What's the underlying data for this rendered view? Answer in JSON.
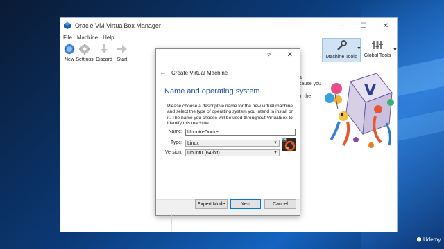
{
  "window": {
    "title": "Oracle VM VirtualBox Manager",
    "controls": {
      "minimize": "—",
      "maximize": "☐",
      "close": "✕"
    }
  },
  "menu": [
    "File",
    "Machine",
    "Help"
  ],
  "toolbar": {
    "new": "New",
    "settings": "Settings",
    "discard": "Discard",
    "start": "Start",
    "machine_tools": "Machine Tools",
    "global_tools": "Global Tools"
  },
  "welcome_fragments": "al\ncause you\n\nin the\nl",
  "dialog": {
    "help": "?",
    "close": "✕",
    "back": "←",
    "title": "Create Virtual Machine",
    "page_title": "Name and operating system",
    "description": "Please choose a descriptive name for the new virtual machine and select the type of operating system you intend to install on it. The name you choose will be used throughout VirtualBox to identify this machine.",
    "name_label": "Name:",
    "name_value": "Ubuntu-Docker",
    "type_label": "Type:",
    "type_value": "Linux",
    "version_label": "Version:",
    "version_value": "Ubuntu (64-bit)",
    "os_badge": "64",
    "buttons": {
      "expert": "Expert Mode",
      "next": "Next",
      "cancel": "Cancel"
    }
  },
  "watermark": "Udemy",
  "colors": {
    "accent": "#1f4e9a",
    "selected_tool_bg": "#cfe3f5",
    "desktop": "#0b3a78"
  }
}
